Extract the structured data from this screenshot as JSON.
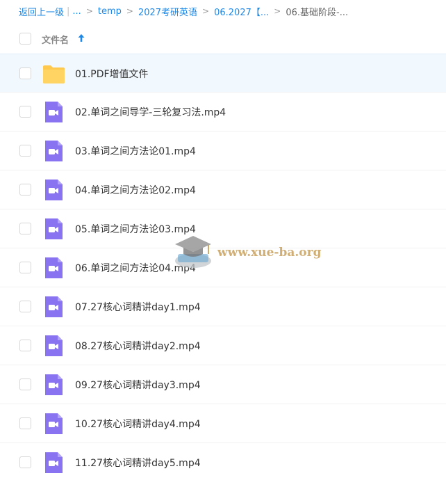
{
  "breadcrumb": {
    "back": "返回上一级",
    "ellipsis": "...",
    "items": [
      "temp",
      "2027考研英语",
      "06.2027【...",
      "06.基础阶段-..."
    ]
  },
  "header": {
    "column_title": "文件名",
    "sort_icon": "sort-ascending-arrow-icon"
  },
  "files": [
    {
      "name": "01.PDF增值文件",
      "icon": "folder-icon",
      "selected": true
    },
    {
      "name": "02.单词之间导学-三轮复习法.mp4",
      "icon": "video-file-icon"
    },
    {
      "name": "03.单词之间方法论01.mp4",
      "icon": "video-file-icon"
    },
    {
      "name": "04.单词之间方法论02.mp4",
      "icon": "video-file-icon"
    },
    {
      "name": "05.单词之间方法论03.mp4",
      "icon": "video-file-icon"
    },
    {
      "name": "06.单词之间方法论04.mp4",
      "icon": "video-file-icon"
    },
    {
      "name": "07.27核心词精讲day1.mp4",
      "icon": "video-file-icon"
    },
    {
      "name": "08.27核心词精讲day2.mp4",
      "icon": "video-file-icon"
    },
    {
      "name": "09.27核心词精讲day3.mp4",
      "icon": "video-file-icon"
    },
    {
      "name": "10.27核心词精讲day4.mp4",
      "icon": "video-file-icon"
    },
    {
      "name": "11.27核心词精讲day5.mp4",
      "icon": "video-file-icon"
    }
  ],
  "watermark": {
    "text": "www.xue-ba.org",
    "icon": "graduation-cap-logo"
  },
  "colors": {
    "link": "#1e88e5",
    "folder": "#ffc94d",
    "video": "#8a73f0",
    "selected_row": "#f1f8fe"
  }
}
